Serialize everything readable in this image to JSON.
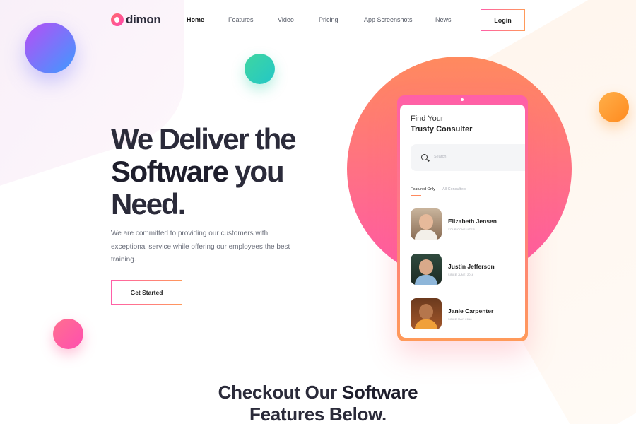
{
  "brand": {
    "name": "dimon",
    "logo_icon": "dimon-logo-mark",
    "accent_gradient": [
      "#ff5fa8",
      "#ff9a5a"
    ]
  },
  "nav": {
    "links": [
      {
        "label": "Home",
        "active": true
      },
      {
        "label": "Features",
        "active": false
      },
      {
        "label": "Video",
        "active": false
      },
      {
        "label": "Pricing",
        "active": false
      },
      {
        "label": "App Screenshots",
        "active": false
      },
      {
        "label": "News",
        "active": false
      }
    ],
    "login_label": "Login"
  },
  "hero": {
    "title_line1": "We Deliver the",
    "title_line2_bold": "Software",
    "title_line2_rest": " you",
    "title_line3": "Need.",
    "description": "We are committed to providing our customers with exceptional service while offering our employees the best training.",
    "cta_label": "Get Started"
  },
  "phone": {
    "title_line1": "Find Your",
    "title_line2": "Trusty Consulter",
    "search_placeholder": "Search",
    "search_icon": "search-icon",
    "tabs": [
      {
        "label": "Featured Only",
        "active": true
      },
      {
        "label": "All Consulters",
        "active": false
      }
    ],
    "consultants": [
      {
        "name": "Elizabeth Jensen",
        "subtitle": "YOUR CONSULTER"
      },
      {
        "name": "Justin Jefferson",
        "subtitle": "SINCE JUNE, 2016"
      },
      {
        "name": "Janie Carpenter",
        "subtitle": "SINCE MAY, 2018"
      }
    ]
  },
  "section": {
    "title_prefix": "Checkout Our ",
    "title_bold": "Software",
    "title_line2": "Features Below."
  }
}
